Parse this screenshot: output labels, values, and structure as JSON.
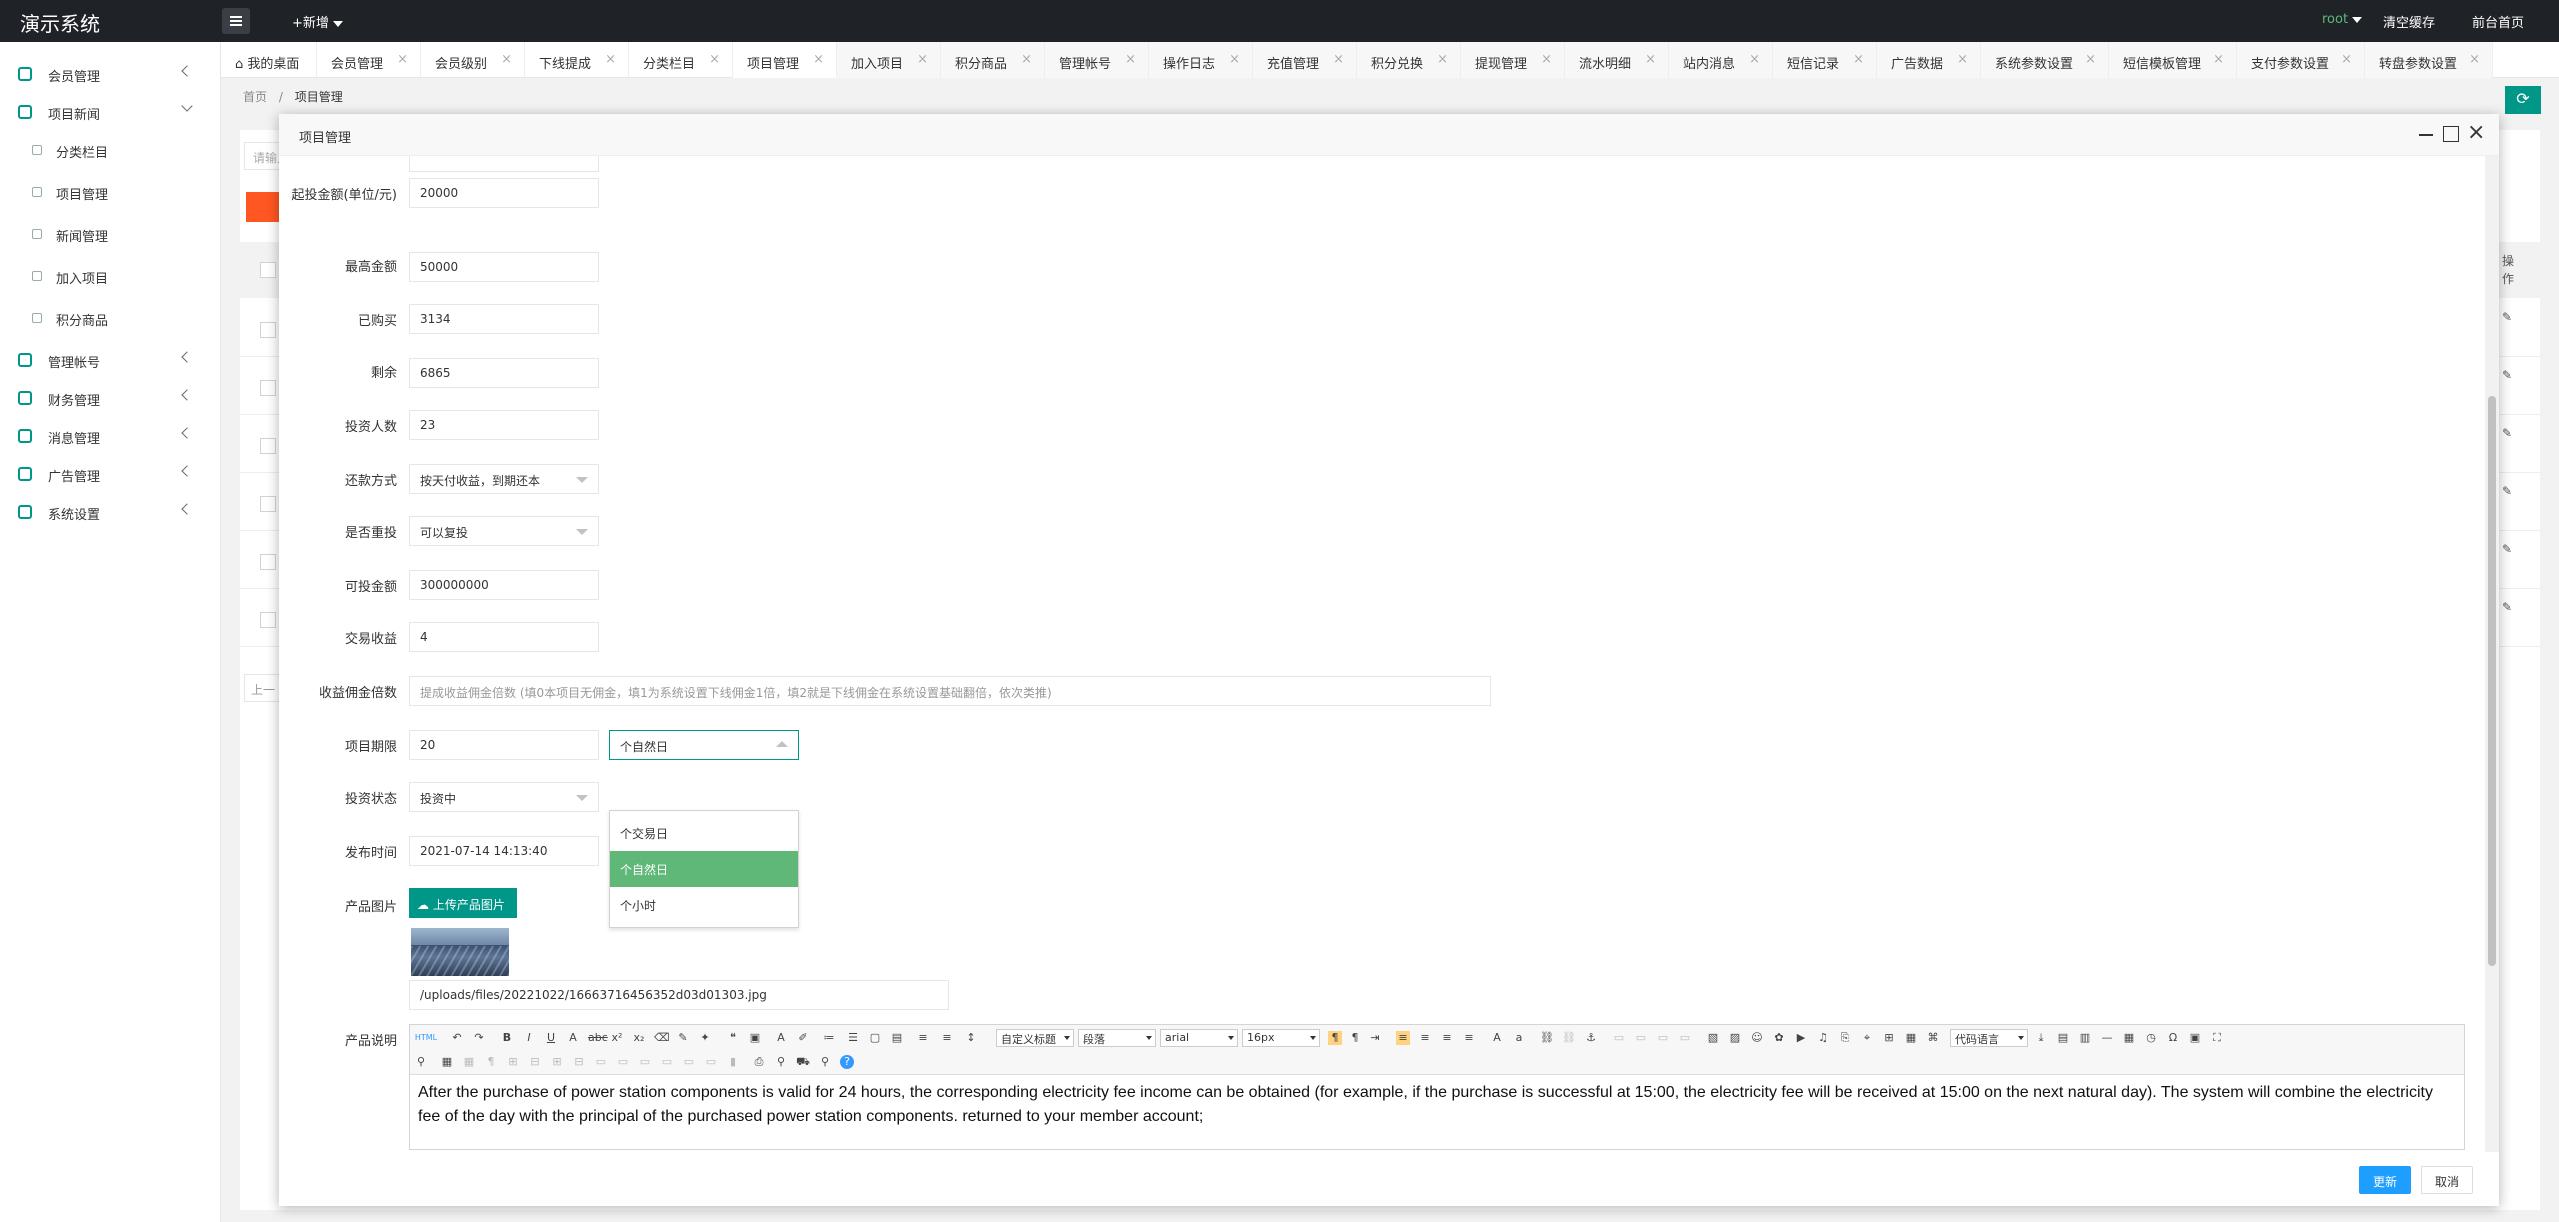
{
  "app": {
    "title": "演示系统",
    "new_label": "+新增",
    "user": "root",
    "clear_cache": "清空缓存",
    "home": "前台首页"
  },
  "sidebar": {
    "items": [
      {
        "label": "会员管理",
        "icon": "user-icon"
      },
      {
        "label": "项目新闻",
        "icon": "book-icon"
      },
      {
        "label": "管理帐号",
        "icon": "admin-icon"
      },
      {
        "label": "财务管理",
        "icon": "finance-icon"
      },
      {
        "label": "消息管理",
        "icon": "message-icon"
      },
      {
        "label": "广告管理",
        "icon": "ad-icon"
      },
      {
        "label": "系统设置",
        "icon": "gear-icon"
      }
    ],
    "sub_items": [
      "分类栏目",
      "项目管理",
      "新闻管理",
      "加入项目",
      "积分商品"
    ]
  },
  "tabs": [
    "我的桌面",
    "会员管理",
    "会员级别",
    "下线提成",
    "分类栏目",
    "项目管理",
    "加入项目",
    "积分商品",
    "管理帐号",
    "操作日志",
    "充值管理",
    "积分兑换",
    "提现管理",
    "流水明细",
    "站内消息",
    "短信记录",
    "广告数据",
    "系统参数设置",
    "短信模板管理",
    "支付参数设置",
    "转盘参数设置"
  ],
  "breadcrumb": {
    "home": "首页",
    "sep": "/",
    "current": "项目管理"
  },
  "background": {
    "search_placeholder": "请输入",
    "op_header": "操作",
    "pager": "上一"
  },
  "modal": {
    "title": "项目管理",
    "fields": {
      "min_invest_label": "起投金额(单位/元)",
      "min_invest": "20000",
      "max_amount_label": "最高金额",
      "max_amount": "50000",
      "purchased_label": "已购买",
      "purchased": "3134",
      "remaining_label": "剩余",
      "remaining": "6865",
      "investors_label": "投资人数",
      "investors": "23",
      "repay_label": "还款方式",
      "repay": "按天付收益，到期还本",
      "reinvest_label": "是否重投",
      "reinvest": "可以复投",
      "investable_label": "可投金额",
      "investable": "300000000",
      "trade_income_label": "交易收益",
      "trade_income": "4",
      "commission_label": "收益佣金倍数",
      "commission_placeholder": "提成收益佣金倍数 (填0本项目无佣金，填1为系统设置下线佣金1倍，填2就是下线佣金在系统设置基础翻倍，依次类推)",
      "period_label": "项目期限",
      "period": "20",
      "period_unit": "个自然日",
      "period_unit_options": [
        "个交易日",
        "个自然日",
        "个小时"
      ],
      "status_label": "投资状态",
      "status": "投资中",
      "publish_label": "发布时间",
      "publish": "2021-07-14 14:13:40",
      "image_label": "产品图片",
      "upload_label": "上传产品图片",
      "image_path": "/uploads/files/20221022/16663716456352d03d01303.jpg",
      "desc_label": "产品说明"
    },
    "editor": {
      "html_label": "HTML",
      "heading_select": "自定义标题",
      "paragraph_select": "段落",
      "font_select": "arial",
      "size_select": "16px",
      "code_select": "代码语言",
      "content": "After the purchase of power station components is valid for 24 hours, the corresponding electricity fee income can be obtained (for example, if the purchase is successful at 15:00, the electricity fee will be received at 15:00 on the next natural day). The system will combine the electricity fee of the day with the principal of the purchased power station components. returned to your member account;"
    },
    "update_label": "更新",
    "cancel_label": "取消"
  },
  "colors": {
    "accent": "#009688",
    "primary": "#1e9fff",
    "selected": "#5fb878",
    "danger": "#ff5722",
    "topbar": "#1f2328",
    "user": "#5fb878"
  }
}
